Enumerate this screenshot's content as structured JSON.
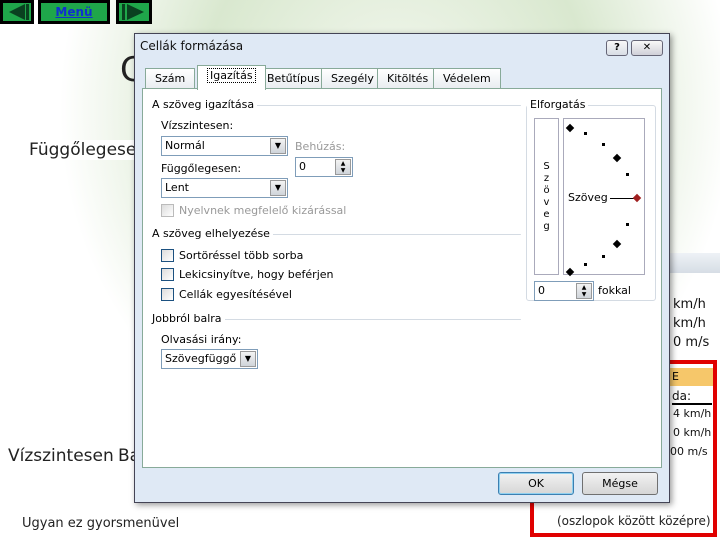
{
  "nav": {
    "prev_icon": "triangle-left-icon",
    "menu_label": "Menü",
    "next_icon": "triangle-right-icon"
  },
  "slide": {
    "heading_partial": "C",
    "left_label1": "Függőlegesen",
    "left_label2": "Vízszintesen",
    "left_label2b": "Ba",
    "bottom_left": "Ugyan ez gyorsmenüvel",
    "bottom_right": "(oszlopok között középre)",
    "cells_top": [
      "km/h",
      "km/h",
      "0 m/s"
    ],
    "cells_box_header": "E",
    "cells_box": [
      "da:",
      "4 km/h",
      "0 km/h",
      "00 m/s"
    ]
  },
  "highlight_color": "#e00000",
  "dialog": {
    "title": "Cellák formázása",
    "help": "?",
    "close": "✕",
    "tabs": [
      "Szám",
      "Igazítás",
      "Betűtípus",
      "Szegély",
      "Kitöltés",
      "Védelem"
    ],
    "active_tab": "Igazítás",
    "alignment": {
      "group": "A szöveg igazítása",
      "horizontal_label": "Vízszintesen:",
      "horizontal_value": "Normál",
      "indent_label": "Behúzás:",
      "indent_value": "0",
      "vertical_label": "Függőlegesen:",
      "vertical_value": "Lent",
      "justify_distributed": "Nyelvnek megfelelő kizárással"
    },
    "text_control": {
      "group": "A szöveg elhelyezése",
      "wrap": "Sortöréssel több sorba",
      "shrink": "Lekicsinyítve, hogy beférjen",
      "merge": "Cellák egyesítésével"
    },
    "rtl": {
      "group": "Jobbról balra",
      "direction_label": "Olvasási irány:",
      "direction_value": "Szövegfüggő"
    },
    "orientation": {
      "group": "Elforgatás",
      "vertical_text": [
        "S",
        "z",
        "ö",
        "v",
        "e",
        "g"
      ],
      "text": "Szöveg",
      "degrees_value": "0",
      "degrees_label": "fokkal"
    },
    "ok": "OK",
    "cancel": "Mégse"
  }
}
